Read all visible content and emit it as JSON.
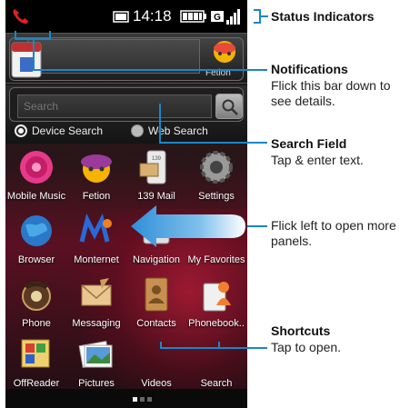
{
  "status_bar": {
    "time": "14:18",
    "icons": [
      "missed-call-icon",
      "sd-card-icon",
      "battery-icon",
      "gprs-icon",
      "signal-icon"
    ]
  },
  "widget": {
    "app_label": "Fetion"
  },
  "search": {
    "placeholder": "Search",
    "option_device": "Device Search",
    "option_web": "Web Search",
    "selected": "Device Search"
  },
  "apps": [
    {
      "label": "Mobile Music",
      "icon": "music-icon"
    },
    {
      "label": "Fetion",
      "icon": "fetion-icon"
    },
    {
      "label": "139 Mail",
      "icon": "mail-icon"
    },
    {
      "label": "Settings",
      "icon": "gear-icon"
    },
    {
      "label": "Browser",
      "icon": "globe-icon"
    },
    {
      "label": "Monternet",
      "icon": "monternet-icon"
    },
    {
      "label": "Navigation",
      "icon": "navigation-icon"
    },
    {
      "label": "My Favorites",
      "icon": "favorites-icon"
    },
    {
      "label": "Phone",
      "icon": "phone-icon"
    },
    {
      "label": "Messaging",
      "icon": "envelope-icon"
    },
    {
      "label": "Contacts",
      "icon": "contacts-icon"
    },
    {
      "label": "Phonebook..",
      "icon": "phonebook-icon"
    },
    {
      "label": "OffReader",
      "icon": "reader-icon"
    },
    {
      "label": "Pictures",
      "icon": "pictures-icon"
    },
    {
      "label": "Videos",
      "icon": "video-icon"
    },
    {
      "label": "Search",
      "icon": "search-icon"
    }
  ],
  "panel_indicator": {
    "current": 1,
    "total": 3
  },
  "callouts": {
    "status_title": "Status Indicators",
    "notifications_title": "Notifications",
    "notifications_text": "Flick this bar down to see details.",
    "search_title": "Search Field",
    "search_text": "Tap & enter text.",
    "panels_text": "Flick left to open more panels.",
    "shortcuts_title": "Shortcuts",
    "shortcuts_text": "Tap to open."
  },
  "colors": {
    "callout_line": "#1a86c8",
    "wallpaper_accent": "#c41e3a"
  }
}
